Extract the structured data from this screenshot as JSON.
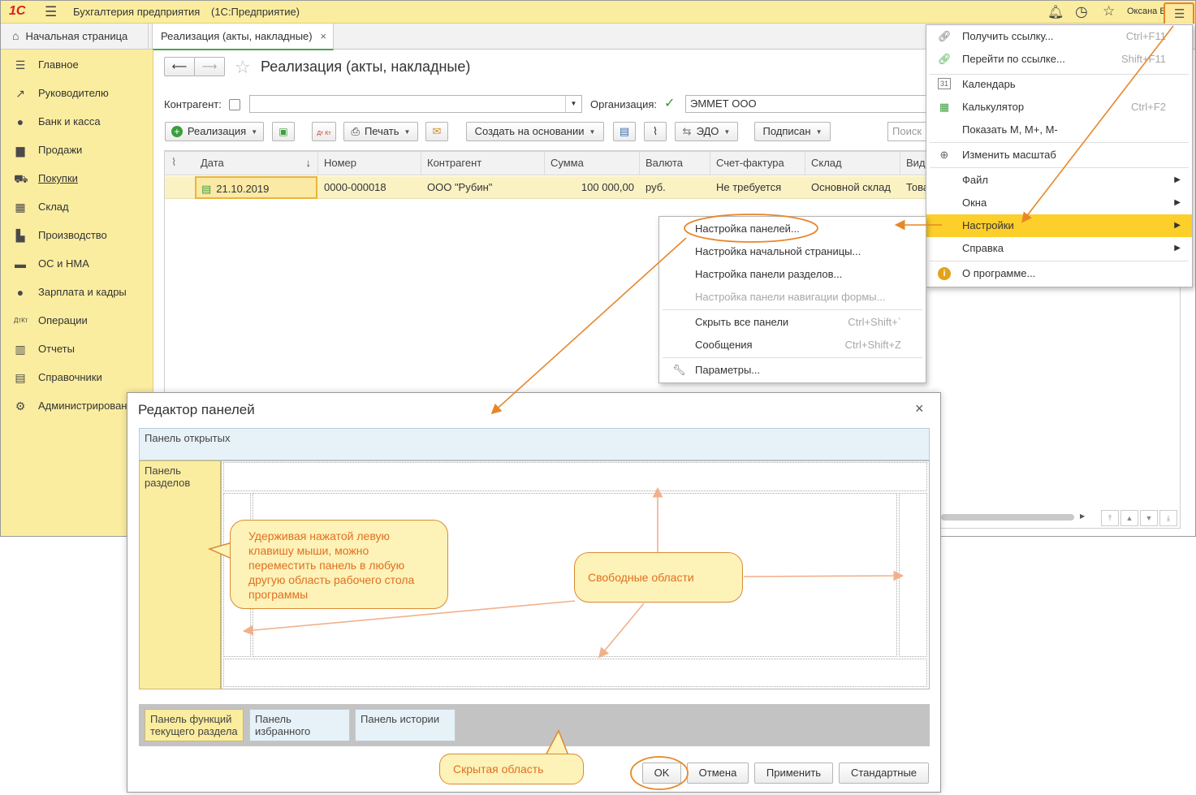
{
  "app": {
    "logo": "1С",
    "title": "Бухгалтерия предприятия",
    "subtitle": "(1С:Предприятие)",
    "user": "Оксана Б"
  },
  "tabs": {
    "home": "Начальная страница",
    "doc": "Реализация (акты, накладные)"
  },
  "sidebar": {
    "items": [
      {
        "label": "Главное",
        "icon": "menu-icon"
      },
      {
        "label": "Руководителю",
        "icon": "chart-line-icon"
      },
      {
        "label": "Банк и касса",
        "icon": "coin-icon"
      },
      {
        "label": "Продажи",
        "icon": "bag-icon"
      },
      {
        "label": "Покупки",
        "icon": "cart-icon"
      },
      {
        "label": "Склад",
        "icon": "warehouse-icon"
      },
      {
        "label": "Производство",
        "icon": "factory-icon"
      },
      {
        "label": "ОС и НМА",
        "icon": "truck-icon"
      },
      {
        "label": "Зарплата и кадры",
        "icon": "person-icon"
      },
      {
        "label": "Операции",
        "icon": "dt-kt-icon"
      },
      {
        "label": "Отчеты",
        "icon": "bar-chart-icon"
      },
      {
        "label": "Справочники",
        "icon": "book-icon"
      },
      {
        "label": "Администрирование",
        "icon": "gear-icon"
      }
    ]
  },
  "form": {
    "title": "Реализация (акты, накладные)",
    "kontragent_label": "Контрагент:",
    "kontragent_value": "",
    "org_label": "Организация:",
    "org_value": "ЭММЕТ ООО"
  },
  "toolbar": {
    "create": "Реализация",
    "print": "Печать",
    "create_based": "Создать на основании",
    "edo": "ЭДО",
    "signed": "Подписан",
    "search_placeholder": "Поиск",
    "dtkt": "Дт Кт"
  },
  "table": {
    "headers": [
      "Дата",
      "Номер",
      "Контрагент",
      "Сумма",
      "Валюта",
      "Счет-фактура",
      "Склад",
      "Вид"
    ],
    "rows": [
      [
        "21.10.2019",
        "0000-000018",
        "ООО \"Рубин\"",
        "100 000,00",
        "руб.",
        "Не требуется",
        "Основной склад",
        "Това"
      ]
    ]
  },
  "main_menu": {
    "items": [
      {
        "label": "Получить ссылку...",
        "shortcut": "Ctrl+F11",
        "icon": "link-icon"
      },
      {
        "label": "Перейти по ссылке...",
        "shortcut": "Shift+F11",
        "icon": "go-link-icon"
      },
      {
        "label": "Календарь",
        "shortcut": "",
        "icon": "calendar-icon"
      },
      {
        "label": "Калькулятор",
        "shortcut": "Ctrl+F2",
        "icon": "calculator-icon"
      },
      {
        "label": "Показать M, M+, M-",
        "shortcut": "",
        "icon": ""
      },
      {
        "label": "Изменить масштаб",
        "shortcut": "",
        "icon": "zoom-icon"
      },
      {
        "label": "Файл",
        "shortcut": "",
        "icon": ""
      },
      {
        "label": "Окна",
        "shortcut": "",
        "icon": ""
      },
      {
        "label": "Настройки",
        "shortcut": "",
        "icon": ""
      },
      {
        "label": "Справка",
        "shortcut": "",
        "icon": ""
      },
      {
        "label": "О программе...",
        "shortcut": "",
        "icon": "info-icon"
      }
    ]
  },
  "settings_menu": {
    "items": [
      {
        "label": "Настройка панелей...",
        "shortcut": ""
      },
      {
        "label": "Настройка начальной страницы...",
        "shortcut": ""
      },
      {
        "label": "Настройка панели разделов...",
        "shortcut": ""
      },
      {
        "label": "Настройка панели навигации формы...",
        "shortcut": ""
      },
      {
        "label": "Скрыть все панели",
        "shortcut": "Ctrl+Shift+`"
      },
      {
        "label": "Сообщения",
        "shortcut": "Ctrl+Shift+Z"
      },
      {
        "label": "Параметры...",
        "shortcut": ""
      }
    ]
  },
  "dialog": {
    "title": "Редактор панелей",
    "open_panel": "Панель открытых",
    "sections_panel": "Панель разделов",
    "functions_panel": "Панель функций текущего раздела",
    "favorites_panel": "Панель избранного",
    "history_panel": "Панель истории",
    "ok": "OK",
    "cancel": "Отмена",
    "apply": "Применить",
    "standard": "Стандартные"
  },
  "callouts": {
    "drag": "Удерживая нажатой левую клавишу мыши, можно переместить панель в любую другую область рабочего стола программы",
    "free": "Свободные области",
    "hidden": "Скрытая область"
  },
  "colors": {
    "accent_yellow": "#fbeda0",
    "highlight": "#fccf2a",
    "annotation_orange": "#e07020",
    "ok_green": "#4aa34a"
  }
}
